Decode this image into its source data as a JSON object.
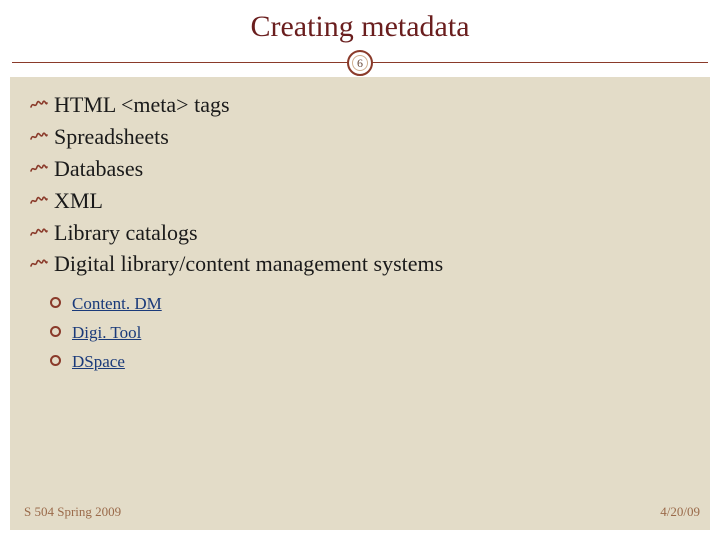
{
  "title": "Creating metadata",
  "page_number": "6",
  "bullets": [
    "HTML <meta> tags",
    "Spreadsheets",
    "Databases",
    "XML",
    "Library catalogs",
    "Digital library/content management systems"
  ],
  "sub_bullets": [
    "Content. DM",
    "Digi. Tool",
    "DSpace"
  ],
  "footer_left": "S 504 Spring 2009",
  "footer_right": "4/20/09"
}
